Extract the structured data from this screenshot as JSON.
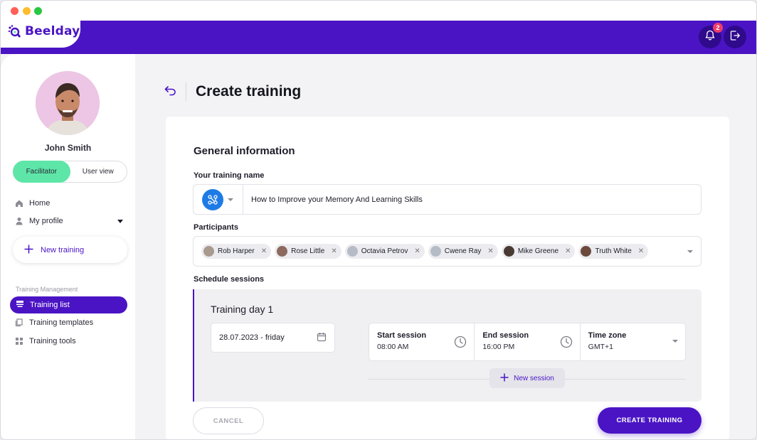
{
  "app": {
    "name": "Beelday",
    "notifications_count": "2",
    "accent": "#4a14c4",
    "success": "#5ee6a8"
  },
  "user": {
    "name": "John Smith"
  },
  "view_toggle": {
    "options": [
      "Facilitator",
      "User view"
    ],
    "active": "Facilitator"
  },
  "sidebar": {
    "nav": [
      {
        "label": "Home",
        "icon": "home-icon"
      },
      {
        "label": "My profile",
        "icon": "person-icon"
      }
    ],
    "new_training_label": "New training",
    "section_label": "Training Management",
    "management": [
      {
        "label": "Training list",
        "icon": "list-icon",
        "active": true
      },
      {
        "label": "Training templates",
        "icon": "copy-icon"
      },
      {
        "label": "Training tools",
        "icon": "grid-icon"
      }
    ]
  },
  "page": {
    "title": "Create training"
  },
  "form": {
    "section_title": "General information",
    "name_label": "Your training name",
    "name_value": "How to Improve your Memory And Learning Skills",
    "participants_label": "Participants",
    "participants": [
      "Rob Harper",
      "Rose Little",
      "Octavia Petrov",
      "Cwene Ray",
      "Mike Greene",
      "Truth White"
    ],
    "schedule_label": "Schedule sessions",
    "day": {
      "title": "Training day 1",
      "date": "28.07.2023 - friday",
      "start_label": "Start session",
      "start_value": "08:00 AM",
      "end_label": "End session",
      "end_value": "16:00 PM",
      "tz_label": "Time zone",
      "tz_value": "GMT+1",
      "new_session_label": "New session"
    },
    "cancel_label": "CANCEL",
    "create_label": "CREATE TRAINING"
  }
}
